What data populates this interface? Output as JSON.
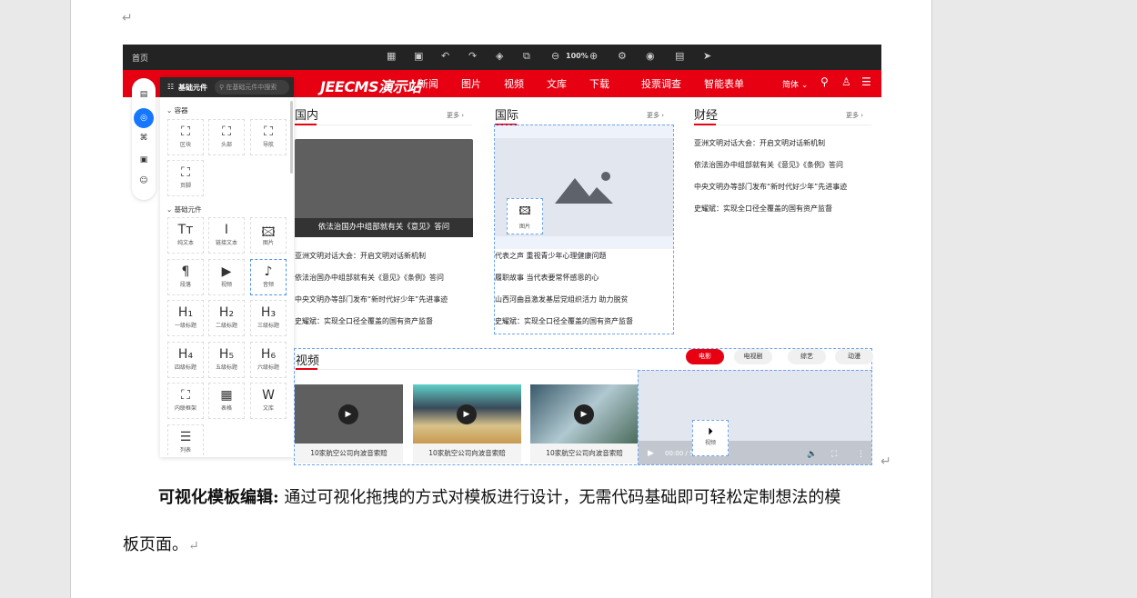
{
  "document": {
    "para_bold": "可视化模板编辑:",
    "para_text": " 通过可视化拖拽的方式对模板进行设计，无需代码基础即可轻松定制想法的模",
    "para_line2": "板页面。",
    "return_mark": "↵"
  },
  "editor": {
    "topbar": {
      "home": "首页",
      "zoom": "100%"
    },
    "site": {
      "logo": "JEECMS演示站",
      "nav": [
        "新闻",
        "图片",
        "视频",
        "文库",
        "下载",
        "投票调查",
        "智能表单"
      ],
      "lang": "简体"
    },
    "panel": {
      "title": "基础元件",
      "search_placeholder": "在基础元件中搜索",
      "section_container": "容器",
      "containers": [
        "区块",
        "头部",
        "导航",
        "页脚"
      ],
      "section_basic": "基础元件",
      "basics": [
        "纯文本",
        "链接文本",
        "图片",
        "段落",
        "视频",
        "音频",
        "一级标题",
        "二级标题",
        "三级标题",
        "四级标题",
        "五级标题",
        "六级标题",
        "内联框架",
        "表格",
        "文库",
        "列表"
      ]
    },
    "columns": [
      {
        "title": "国内",
        "more": "更多",
        "caption": "依法治国办中组部就有关《意见》答问",
        "items": [
          "亚洲文明对话大会：开启文明对话新机制",
          "依法治国办中组部就有关《意见》《条例》答问",
          "中央文明办等部门发布“新时代好少年”先进事迹",
          "史耀斌：实现全口径全覆盖的国有资产监督"
        ]
      },
      {
        "title": "国际",
        "more": "更多",
        "drag_label": "图片",
        "items": [
          "代表之声 重视青少年心理健康问题",
          "履职故事 当代表要常怀感恩的心",
          "山西河曲县激发基层党组织活力 助力脱贫",
          "史耀斌：实现全口径全覆盖的国有资产监督"
        ]
      },
      {
        "title": "财经",
        "more": "更多",
        "items": [
          "亚洲文明对话大会：开启文明对话新机制",
          "依法治国办中组部就有关《意见》《条例》答问",
          "中央文明办等部门发布“新时代好少年”先进事迹",
          "史耀斌：实现全口径全覆盖的国有资产监督"
        ]
      }
    ],
    "video": {
      "title": "视频",
      "tabs": [
        "电影",
        "电视剧",
        "综艺",
        "动漫"
      ],
      "active_tab": 0,
      "cards": [
        "10家航空公司向波音索赔",
        "10家航空公司向波音索赔",
        "10家航空公司向波音索赔"
      ],
      "player_time": "00:00 / 5",
      "drag_label": "视频"
    }
  },
  "colors": {
    "brand": "#e60012",
    "accent": "#1677ff"
  }
}
